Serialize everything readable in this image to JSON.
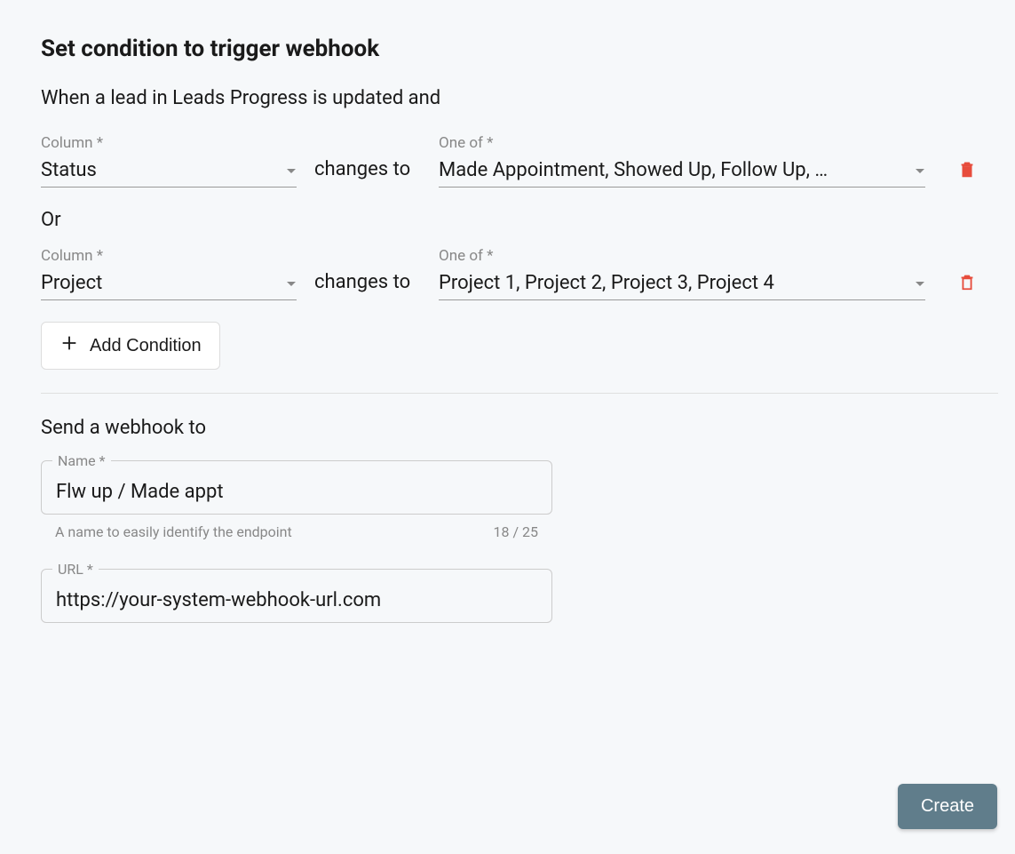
{
  "title": "Set condition to trigger webhook",
  "intro": "When a lead in Leads Progress is updated and",
  "labels": {
    "column": "Column *",
    "one_of": "One of *",
    "changes_to": "changes to",
    "or": "Or",
    "add_condition": "Add Condition",
    "send_to": "Send a webhook to",
    "name": "Name *",
    "url": "URL *",
    "name_helper": "A name to easily identify the endpoint",
    "create": "Create"
  },
  "conditions": [
    {
      "column": "Status",
      "one_of": "Made Appointment, Showed Up, Follow Up, …"
    },
    {
      "column": "Project",
      "one_of": "Project 1, Project 2, Project 3, Project 4"
    }
  ],
  "webhook": {
    "name": "Flw up / Made appt",
    "name_count": "18 / 25",
    "url": "https://your-system-webhook-url.com"
  }
}
